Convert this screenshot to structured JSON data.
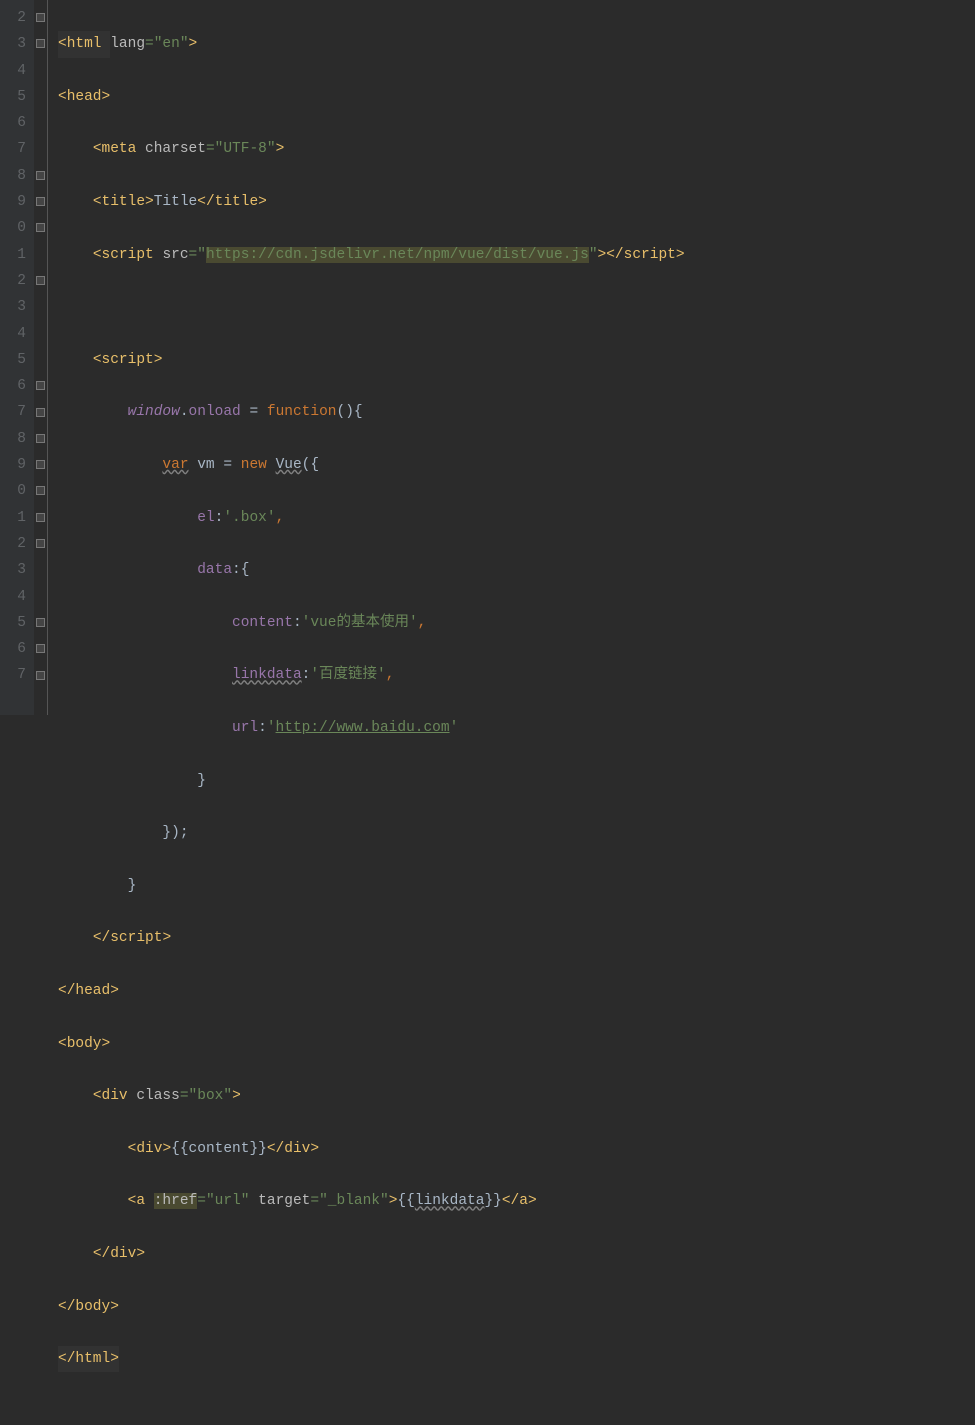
{
  "gutter": [
    "2",
    "3",
    "4",
    "5",
    "6",
    "7",
    "8",
    "9",
    "0",
    "1",
    "2",
    "3",
    "4",
    "5",
    "6",
    "7",
    "8",
    "9",
    "0",
    "1",
    "2",
    "3",
    "4",
    "5",
    "6",
    "7"
  ],
  "code": {
    "l1": {
      "t1": "<",
      "t2": "html ",
      "a1": "lang",
      "eq": "=",
      "v1": "\"en\"",
      "t3": ">"
    },
    "l2": {
      "t1": "<",
      "t2": "head",
      "t3": ">"
    },
    "l3": {
      "t1": "<",
      "t2": "meta ",
      "a1": "charset",
      "eq": "=",
      "v1": "\"UTF-8\"",
      "t3": ">"
    },
    "l4": {
      "t1": "<",
      "t2": "title",
      "t3": ">",
      "txt": "Title",
      "t4": "</",
      "t5": "title",
      "t6": ">"
    },
    "l5": {
      "t1": "<",
      "t2": "script ",
      "a1": "src",
      "eq": "=",
      "q1": "\"",
      "url": "https://cdn.jsdelivr.net/npm/vue/dist/vue.js",
      "q2": "\"",
      "t3": "></",
      "t4": "script",
      "t5": ">"
    },
    "l7": {
      "t1": "<",
      "t2": "script",
      "t3": ">"
    },
    "l8": {
      "w": "window",
      "d": ".",
      "on": "onload ",
      "eq": "= ",
      "fn": "function",
      "p": "(){"
    },
    "l9": {
      "v": "var",
      "sp": " ",
      "vm": "vm ",
      "eq": "= ",
      "nw": "new ",
      "vue": "Vue",
      "p": "({"
    },
    "l10": {
      "k": "el",
      "c": ":",
      "v": "'.box'",
      "cm": ","
    },
    "l11": {
      "k": "data",
      "c": ":",
      "b": "{"
    },
    "l12": {
      "k": "content",
      "c": ":",
      "v": "'vue的基本使用'",
      "cm": ","
    },
    "l13": {
      "k": "linkdata",
      "c": ":",
      "v": "'百度链接'",
      "cm": ","
    },
    "l14": {
      "k": "url",
      "c": ":",
      "q": "'",
      "link": "http://www.baidu.com",
      "q2": "'"
    },
    "l15": {
      "b": "}"
    },
    "l16": {
      "b": "});"
    },
    "l17": {
      "b": "}"
    },
    "l18": {
      "t1": "</",
      "t2": "script",
      "t3": ">"
    },
    "l19": {
      "t1": "</",
      "t2": "head",
      "t3": ">"
    },
    "l20": {
      "t1": "<",
      "t2": "body",
      "t3": ">"
    },
    "l21": {
      "t1": "<",
      "t2": "div ",
      "a1": "class",
      "eq": "=",
      "v1": "\"box\"",
      "t3": ">"
    },
    "l22": {
      "t1": "<",
      "t2": "div",
      "t3": ">",
      "txt": "{{content}}",
      "t4": "</",
      "t5": "div",
      "t6": ">"
    },
    "l23": {
      "t1": "<",
      "t2": "a ",
      "a1": ":href",
      "eq": "=",
      "v1": "\"url\" ",
      "a2": "target",
      "eq2": "=",
      "v2": "\"_blank\"",
      "t3": ">",
      "b1": "{{",
      "ld": "linkdata",
      "b2": "}}",
      "t4": "</",
      "t5": "a",
      "t6": ">"
    },
    "l24": {
      "t1": "</",
      "t2": "div",
      "t3": ">"
    },
    "l25": {
      "t1": "</",
      "t2": "body",
      "t3": ">"
    },
    "l26": {
      "t1": "</",
      "t2": "html",
      "t3": ">"
    }
  }
}
